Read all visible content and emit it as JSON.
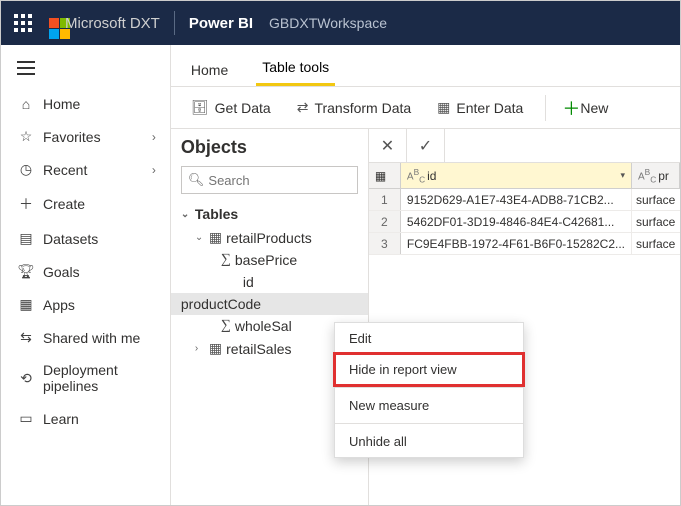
{
  "topbar": {
    "brand_ms": "Microsoft",
    "brand_dxt": "DXT",
    "product": "Power BI",
    "workspace": "GBDXTWorkspace"
  },
  "sidebar": {
    "items": [
      {
        "icon": "home-icon",
        "label": "Home",
        "chevron": false
      },
      {
        "icon": "star-icon",
        "label": "Favorites",
        "chevron": true
      },
      {
        "icon": "clock-icon",
        "label": "Recent",
        "chevron": true
      },
      {
        "icon": "plus-icon",
        "label": "Create",
        "chevron": false
      },
      {
        "icon": "datasets-icon",
        "label": "Datasets",
        "chevron": false
      },
      {
        "icon": "trophy-icon",
        "label": "Goals",
        "chevron": false
      },
      {
        "icon": "apps-icon",
        "label": "Apps",
        "chevron": false
      },
      {
        "icon": "shared-icon",
        "label": "Shared with me",
        "chevron": false
      },
      {
        "icon": "pipeline-icon",
        "label": "Deployment pipelines",
        "chevron": false
      },
      {
        "icon": "learn-icon",
        "label": "Learn",
        "chevron": false
      }
    ]
  },
  "tabs": {
    "home": "Home",
    "tabletools": "Table tools"
  },
  "toolbar": {
    "getdata": "Get Data",
    "transform": "Transform Data",
    "enter": "Enter Data",
    "new": "New"
  },
  "objects": {
    "title": "Objects",
    "search_placeholder": "Search",
    "tables_label": "Tables",
    "tree": {
      "table1": "retailProducts",
      "col_basePrice": "basePrice",
      "col_id": "id",
      "col_productCode": "productCode",
      "col_wholeSale": "wholeSal",
      "table2": "retailSales"
    }
  },
  "grid": {
    "col_id_label": "id",
    "col_pr_label": "pr",
    "rows": [
      {
        "n": "1",
        "id": "9152D629-A1E7-43E4-ADB8-71CB2...",
        "pr": "surface"
      },
      {
        "n": "2",
        "id": "5462DF01-3D19-4846-84E4-C42681...",
        "pr": "surface"
      },
      {
        "n": "3",
        "id": "FC9E4FBB-1972-4F61-B6F0-15282C2...",
        "pr": "surface"
      }
    ]
  },
  "context_menu": {
    "edit": "Edit",
    "hide": "Hide in report view",
    "new_measure": "New measure",
    "unhide": "Unhide all"
  }
}
